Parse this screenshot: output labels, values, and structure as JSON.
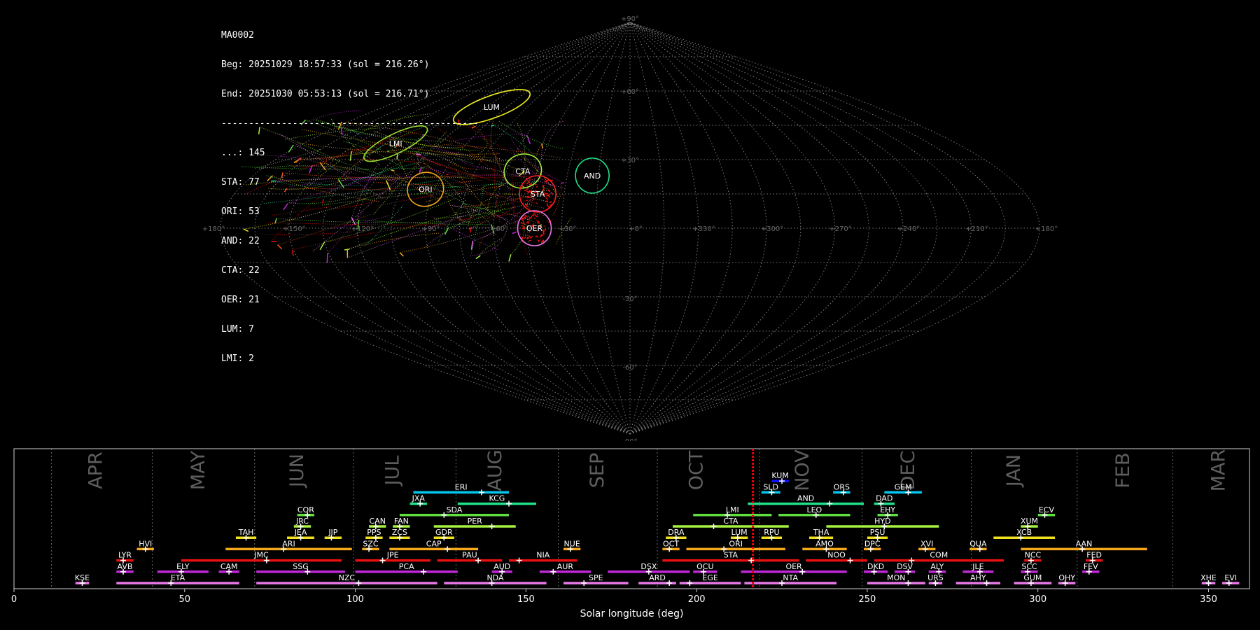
{
  "info": {
    "id": "MA0002",
    "beg": "Beg: 20251029 18:57:33 (sol = 216.26°)",
    "end": "End: 20251030 05:53:13 (sol = 216.71°)",
    "separator": "-----------------------------------------------",
    "counts": [
      {
        "label": "...: 145"
      },
      {
        "label": "STA: 77"
      },
      {
        "label": "ORI: 53"
      },
      {
        "label": "AND: 22"
      },
      {
        "label": "CTA: 22"
      },
      {
        "label": "OER: 21"
      },
      {
        "label": "LUM: 7"
      },
      {
        "label": "LMI: 2"
      }
    ]
  },
  "chart_data": [
    {
      "type": "scatter",
      "projection": "sinusoidal",
      "lon_ticks": [
        "+180°",
        "+150°",
        "+120°",
        "+90°",
        "+60°",
        "+30°",
        "+0°",
        "+330°",
        "+300°",
        "+270°",
        "+240°",
        "+210°",
        "+180°"
      ],
      "lat_ticks": [
        "+90°",
        "+60°",
        "+30°",
        "-30°",
        "-60°",
        "-90°"
      ],
      "radiants": [
        {
          "code": "LUM",
          "lon": 101,
          "lat": 53,
          "color": "#f0f020"
        },
        {
          "code": "LMI",
          "lon": 129,
          "lat": 37,
          "color": "#9adf30"
        },
        {
          "code": "ORI",
          "lon": 94,
          "lat": 17,
          "color": "#f5a81c"
        },
        {
          "code": "CTA",
          "lon": 52,
          "lat": 25,
          "color": "#a6f040"
        },
        {
          "code": "STA",
          "lon": 42,
          "lat": 15,
          "color": "#ff2020"
        },
        {
          "code": "AND",
          "lon": 18,
          "lat": 23,
          "color": "#20e08a"
        },
        {
          "code": "OER",
          "lon": 42,
          "lat": 0,
          "color": "#e878e8"
        }
      ]
    },
    {
      "type": "bar",
      "xlabel": "Solar longitude (deg)",
      "xlim": [
        0,
        362
      ],
      "x_ticks": [
        "0",
        "50",
        "100",
        "150",
        "200",
        "250",
        "300",
        "350"
      ],
      "current_sol": 216.5,
      "months": [
        {
          "label": "APR",
          "x": 24
        },
        {
          "label": "MAY",
          "x": 54
        },
        {
          "label": "JUN",
          "x": 83
        },
        {
          "label": "JUL",
          "x": 111
        },
        {
          "label": "AUG",
          "x": 141
        },
        {
          "label": "SEP",
          "x": 171
        },
        {
          "label": "OCT",
          "x": 200
        },
        {
          "label": "NOV",
          "x": 231
        },
        {
          "label": "DEC",
          "x": 262
        },
        {
          "label": "JAN",
          "x": 293
        },
        {
          "label": "FEB",
          "x": 325
        },
        {
          "label": "MAR",
          "x": 353
        }
      ],
      "month_lines": [
        11,
        40.5,
        70.5,
        99.5,
        129.5,
        159.5,
        188.5,
        218.5,
        248.5,
        280.5,
        311.5,
        339.5
      ],
      "showers": [
        {
          "code": "KUM",
          "start": 222,
          "end": 227,
          "peak": 225,
          "row": 10,
          "color": "#1010ff"
        },
        {
          "code": "ERI",
          "start": 117,
          "end": 145,
          "peak": 137,
          "row": 9,
          "color": "#00c8f0"
        },
        {
          "code": "SLD",
          "start": 219,
          "end": 224.5,
          "peak": 222,
          "row": 9,
          "color": "#00c8f0"
        },
        {
          "code": "ORS",
          "start": 240,
          "end": 245,
          "peak": 243,
          "row": 9,
          "color": "#00c8f0"
        },
        {
          "code": "GEM",
          "start": 255,
          "end": 266,
          "peak": 262,
          "row": 9,
          "color": "#00c8f0"
        },
        {
          "code": "JXA",
          "start": 116,
          "end": 121,
          "peak": 119,
          "row": 8,
          "color": "#20e08a"
        },
        {
          "code": "KCG",
          "start": 130,
          "end": 153,
          "peak": 145,
          "row": 8,
          "color": "#20e08a"
        },
        {
          "code": "AND",
          "start": 215,
          "end": 249,
          "peak": 239,
          "row": 8,
          "color": "#20e08a"
        },
        {
          "code": "DAD",
          "start": 252,
          "end": 258,
          "peak": 254,
          "row": 8,
          "color": "#20e08a"
        },
        {
          "code": "COR",
          "start": 83,
          "end": 88,
          "peak": 86,
          "row": 7,
          "color": "#60e040"
        },
        {
          "code": "SDA",
          "start": 113,
          "end": 145,
          "peak": 126,
          "row": 7,
          "color": "#60e040"
        },
        {
          "code": "LMI",
          "start": 199,
          "end": 222,
          "peak": 209,
          "row": 7,
          "color": "#60e040"
        },
        {
          "code": "LEO",
          "start": 224,
          "end": 245,
          "peak": 235,
          "row": 7,
          "color": "#60e040"
        },
        {
          "code": "EHY",
          "start": 253,
          "end": 259,
          "peak": 256,
          "row": 7,
          "color": "#60e040"
        },
        {
          "code": "ECV",
          "start": 300,
          "end": 305,
          "peak": 302,
          "row": 7,
          "color": "#60e040"
        },
        {
          "code": "JRC",
          "start": 82,
          "end": 87,
          "peak": 84,
          "row": 6,
          "color": "#a6f040"
        },
        {
          "code": "CAN",
          "start": 104,
          "end": 109,
          "peak": 106,
          "row": 6,
          "color": "#a6f040"
        },
        {
          "code": "FAN",
          "start": 111,
          "end": 116,
          "peak": 113,
          "row": 6,
          "color": "#a6f040"
        },
        {
          "code": "PER",
          "start": 123,
          "end": 147,
          "peak": 140,
          "row": 6,
          "color": "#a6f040"
        },
        {
          "code": "CTA",
          "start": 193,
          "end": 227,
          "peak": 205,
          "row": 6,
          "color": "#a6f040"
        },
        {
          "code": "HYD",
          "start": 238,
          "end": 271,
          "peak": 255,
          "row": 6,
          "color": "#a6f040"
        },
        {
          "code": "XUM",
          "start": 295,
          "end": 300,
          "peak": 297,
          "row": 6,
          "color": "#a6f040"
        },
        {
          "code": "TAH",
          "start": 65,
          "end": 71,
          "peak": 68,
          "row": 5,
          "color": "#f0e020"
        },
        {
          "code": "JEA",
          "start": 80,
          "end": 88,
          "peak": 84,
          "row": 5,
          "color": "#f0e020"
        },
        {
          "code": "JIP",
          "start": 91,
          "end": 96,
          "peak": 93,
          "row": 5,
          "color": "#f0e020"
        },
        {
          "code": "PPS",
          "start": 103,
          "end": 108,
          "peak": 106,
          "row": 5,
          "color": "#f0e020"
        },
        {
          "code": "ZCS",
          "start": 110,
          "end": 116,
          "peak": 113,
          "row": 5,
          "color": "#f0e020"
        },
        {
          "code": "GDR",
          "start": 123,
          "end": 129,
          "peak": 126,
          "row": 5,
          "color": "#f0e020"
        },
        {
          "code": "DRA",
          "start": 191,
          "end": 197,
          "peak": 194,
          "row": 5,
          "color": "#f0e020"
        },
        {
          "code": "LUM",
          "start": 210,
          "end": 215,
          "peak": 212,
          "row": 5,
          "color": "#f0e020"
        },
        {
          "code": "RPU",
          "start": 219,
          "end": 225,
          "peak": 222,
          "row": 5,
          "color": "#f0e020"
        },
        {
          "code": "THA",
          "start": 233,
          "end": 240,
          "peak": 236,
          "row": 5,
          "color": "#f0e020"
        },
        {
          "code": "PSU",
          "start": 250,
          "end": 256,
          "peak": 253,
          "row": 5,
          "color": "#f0e020"
        },
        {
          "code": "XCB",
          "start": 287,
          "end": 305,
          "peak": 295,
          "row": 5,
          "color": "#f0e020"
        },
        {
          "code": "HVI",
          "start": 36,
          "end": 41,
          "peak": 38.5,
          "row": 4,
          "color": "#f5a81c"
        },
        {
          "code": "ARI",
          "start": 62,
          "end": 99,
          "peak": 79,
          "row": 4,
          "color": "#f5a81c"
        },
        {
          "code": "SZC",
          "start": 102,
          "end": 107,
          "peak": 104,
          "row": 4,
          "color": "#f5a81c"
        },
        {
          "code": "CAP",
          "start": 110,
          "end": 136,
          "peak": 127,
          "row": 4,
          "color": "#f5a81c"
        },
        {
          "code": "NUE",
          "start": 161,
          "end": 166,
          "peak": 163,
          "row": 4,
          "color": "#f5a81c"
        },
        {
          "code": "OCT",
          "start": 190,
          "end": 195,
          "peak": 192,
          "row": 4,
          "color": "#f5a81c"
        },
        {
          "code": "ORI",
          "start": 197,
          "end": 226,
          "peak": 208,
          "row": 4,
          "color": "#f5a81c"
        },
        {
          "code": "AMO",
          "start": 231,
          "end": 244,
          "peak": 238,
          "row": 4,
          "color": "#f5a81c"
        },
        {
          "code": "DPC",
          "start": 249,
          "end": 254,
          "peak": 251,
          "row": 4,
          "color": "#f5a81c"
        },
        {
          "code": "XVI",
          "start": 265,
          "end": 270,
          "peak": 267,
          "row": 4,
          "color": "#f5a81c"
        },
        {
          "code": "QUA",
          "start": 280,
          "end": 285,
          "peak": 283,
          "row": 4,
          "color": "#f5a81c"
        },
        {
          "code": "AAN",
          "start": 295,
          "end": 332,
          "peak": 313,
          "row": 4,
          "color": "#f5a81c"
        },
        {
          "code": "LYR",
          "start": 30,
          "end": 35,
          "peak": 32,
          "row": 3,
          "color": "#e81010"
        },
        {
          "code": "JMC",
          "start": 49,
          "end": 96,
          "peak": 74,
          "row": 3,
          "color": "#e81010"
        },
        {
          "code": "JPE",
          "start": 100,
          "end": 122,
          "peak": 108,
          "row": 3,
          "color": "#e81010"
        },
        {
          "code": "PAU",
          "start": 124,
          "end": 143,
          "peak": 136,
          "row": 3,
          "color": "#e81010"
        },
        {
          "code": "NIA",
          "start": 145,
          "end": 165,
          "peak": 148,
          "row": 3,
          "color": "#e81010"
        },
        {
          "code": "STA",
          "start": 190,
          "end": 230,
          "peak": 216,
          "row": 3,
          "color": "#e81010"
        },
        {
          "code": "NOO",
          "start": 232,
          "end": 250,
          "peak": 245,
          "row": 3,
          "color": "#e81010"
        },
        {
          "code": "COM",
          "start": 252,
          "end": 290,
          "peak": 263,
          "row": 3,
          "color": "#e81010"
        },
        {
          "code": "NCC",
          "start": 296,
          "end": 301,
          "peak": 298,
          "row": 3,
          "color": "#e81010"
        },
        {
          "code": "FED",
          "start": 314,
          "end": 319,
          "peak": 316,
          "row": 3,
          "color": "#e81010"
        },
        {
          "code": "AVB",
          "start": 30,
          "end": 35,
          "peak": 32,
          "row": 2,
          "color": "#c028d8"
        },
        {
          "code": "ELY",
          "start": 42,
          "end": 57,
          "peak": 49,
          "row": 2,
          "color": "#c028d8"
        },
        {
          "code": "CAM",
          "start": 60,
          "end": 66,
          "peak": 63,
          "row": 2,
          "color": "#c028d8"
        },
        {
          "code": "SSG",
          "start": 71,
          "end": 97,
          "peak": 86,
          "row": 2,
          "color": "#c028d8"
        },
        {
          "code": "PCA",
          "start": 100,
          "end": 130,
          "peak": 120,
          "row": 2,
          "color": "#c028d8"
        },
        {
          "code": "AUD",
          "start": 140,
          "end": 146,
          "peak": 143,
          "row": 2,
          "color": "#c028d8"
        },
        {
          "code": "AUR",
          "start": 154,
          "end": 169,
          "peak": 158,
          "row": 2,
          "color": "#c028d8"
        },
        {
          "code": "DSX",
          "start": 174,
          "end": 198,
          "peak": 186,
          "row": 2,
          "color": "#c028d8"
        },
        {
          "code": "OCU",
          "start": 199,
          "end": 206,
          "peak": 202,
          "row": 2,
          "color": "#c028d8"
        },
        {
          "code": "OER",
          "start": 213,
          "end": 244,
          "peak": 231,
          "row": 2,
          "color": "#c028d8"
        },
        {
          "code": "DKD",
          "start": 249,
          "end": 256,
          "peak": 252,
          "row": 2,
          "color": "#c028d8"
        },
        {
          "code": "DSV",
          "start": 258,
          "end": 264,
          "peak": 262,
          "row": 2,
          "color": "#c028d8"
        },
        {
          "code": "ALY",
          "start": 268,
          "end": 273,
          "peak": 271,
          "row": 2,
          "color": "#c028d8"
        },
        {
          "code": "JLE",
          "start": 278,
          "end": 287,
          "peak": 283,
          "row": 2,
          "color": "#c028d8"
        },
        {
          "code": "SCC",
          "start": 295,
          "end": 300,
          "peak": 297,
          "row": 2,
          "color": "#c028d8"
        },
        {
          "code": "FEV",
          "start": 313,
          "end": 318,
          "peak": 315,
          "row": 2,
          "color": "#c028d8"
        },
        {
          "code": "KSE",
          "start": 18,
          "end": 22,
          "peak": 20,
          "row": 1,
          "color": "#e878e8"
        },
        {
          "code": "ETA",
          "start": 30,
          "end": 66,
          "peak": 46,
          "row": 1,
          "color": "#e878e8"
        },
        {
          "code": "NZC",
          "start": 71,
          "end": 124,
          "peak": 101,
          "row": 1,
          "color": "#e878e8"
        },
        {
          "code": "NDA",
          "start": 126,
          "end": 156,
          "peak": 140,
          "row": 1,
          "color": "#e878e8"
        },
        {
          "code": "SPE",
          "start": 161,
          "end": 180,
          "peak": 167,
          "row": 1,
          "color": "#e878e8"
        },
        {
          "code": "ARD",
          "start": 183,
          "end": 194,
          "peak": 192,
          "row": 1,
          "color": "#e878e8"
        },
        {
          "code": "EGE",
          "start": 195,
          "end": 213,
          "peak": 198,
          "row": 1,
          "color": "#e878e8"
        },
        {
          "code": "NTA",
          "start": 214,
          "end": 241,
          "peak": 225,
          "row": 1,
          "color": "#e878e8"
        },
        {
          "code": "MON",
          "start": 250,
          "end": 267,
          "peak": 262,
          "row": 1,
          "color": "#e878e8"
        },
        {
          "code": "URS",
          "start": 268,
          "end": 272,
          "peak": 270,
          "row": 1,
          "color": "#e878e8"
        },
        {
          "code": "AHY",
          "start": 276,
          "end": 289,
          "peak": 285,
          "row": 1,
          "color": "#e878e8"
        },
        {
          "code": "GUM",
          "start": 293,
          "end": 304,
          "peak": 298,
          "row": 1,
          "color": "#e878e8"
        },
        {
          "code": "OHY",
          "start": 306,
          "end": 311,
          "peak": 308,
          "row": 1,
          "color": "#e878e8"
        },
        {
          "code": "XHE",
          "start": 348,
          "end": 352,
          "peak": 350,
          "row": 1,
          "color": "#e878e8"
        },
        {
          "code": "EVI",
          "start": 354,
          "end": 359,
          "peak": 356,
          "row": 1,
          "color": "#e878e8"
        }
      ]
    }
  ]
}
